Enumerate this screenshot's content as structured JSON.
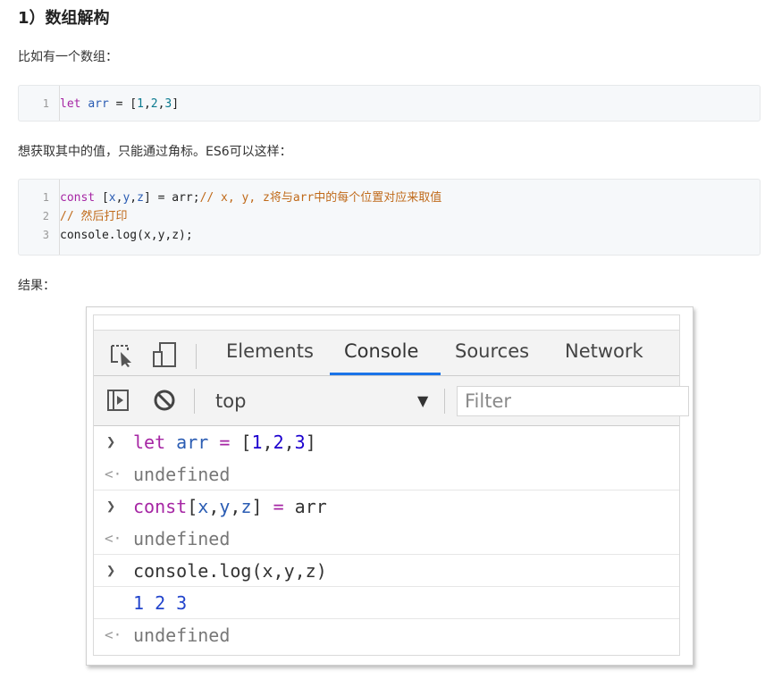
{
  "heading": "1）数组解构",
  "para1": "比如有一个数组：",
  "para2": "想获取其中的值，只能通过角标。ES6可以这样：",
  "para3": "结果：",
  "code1": {
    "lines": [
      {
        "n": "1",
        "parts": [
          "let",
          " ",
          "arr",
          " = [",
          "1",
          ",",
          "2",
          ",",
          "3",
          "]"
        ]
      }
    ]
  },
  "code2": {
    "line1": {
      "n": "1",
      "kw": "const",
      "open": " [",
      "x": "x",
      "c1": ",",
      "y": "y",
      "c2": ",",
      "z": "z",
      "rest": "] = arr;",
      "comment": "// x, y, z将与arr中的每个位置对应来取值"
    },
    "line2": {
      "n": "2",
      "comment": "// 然后打印"
    },
    "line3": {
      "n": "3",
      "text": "console.log(x,y,z);"
    }
  },
  "devtools": {
    "tabs": [
      "Elements",
      "Console",
      "Sources",
      "Network"
    ],
    "active_tab": "Console",
    "context": "top",
    "filter_placeholder": "Filter",
    "icons": [
      "inspect-icon",
      "device-toolbar-icon",
      "sidebar-toggle-icon",
      "clear-console-icon",
      "dropdown-arrow-icon"
    ],
    "accent": "#1a73e8",
    "rows": {
      "r1": {
        "kw": "let",
        "var": "arr",
        "op": " = ",
        "rest": "[",
        "n1": "1",
        "n2": "2",
        "n3": "3",
        "end": "]"
      },
      "r2": "undefined",
      "r3": {
        "kw": "const",
        "open": "[",
        "x": "x",
        "y": "y",
        "z": "z",
        "close": "]",
        "op": " = ",
        "rhs": "arr"
      },
      "r4": "undefined",
      "r5": "console.log(x,y,z)",
      "r6": "1 2 3",
      "r7": "undefined"
    }
  }
}
